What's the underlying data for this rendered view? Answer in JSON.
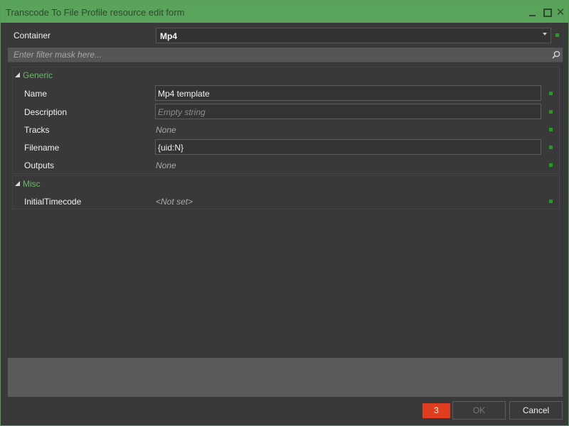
{
  "window": {
    "title": "Transcode To File Profile resource edit form"
  },
  "container": {
    "label": "Container",
    "value": "Mp4"
  },
  "filter": {
    "placeholder": "Enter filter mask here..."
  },
  "groups": {
    "generic": {
      "label": "Generic",
      "rows": {
        "name": {
          "label": "Name",
          "value": "Mp4 template"
        },
        "description": {
          "label": "Description",
          "placeholder": "Empty string"
        },
        "tracks": {
          "label": "Tracks",
          "value": "None"
        },
        "filename": {
          "label": "Filename",
          "value": "{uid:N}"
        },
        "outputs": {
          "label": "Outputs",
          "value": "None"
        }
      }
    },
    "misc": {
      "label": "Misc",
      "rows": {
        "initial_timecode": {
          "label": "InitialTimecode",
          "value": "<Not set>"
        }
      }
    }
  },
  "footer": {
    "error_count": "3",
    "ok_label": "OK",
    "cancel_label": "Cancel"
  },
  "colors": {
    "title_bar": "#5aa35a",
    "group_header_text": "#6ab56a",
    "status_indicator": "#1ea01e",
    "error_badge": "#e03c1e"
  }
}
